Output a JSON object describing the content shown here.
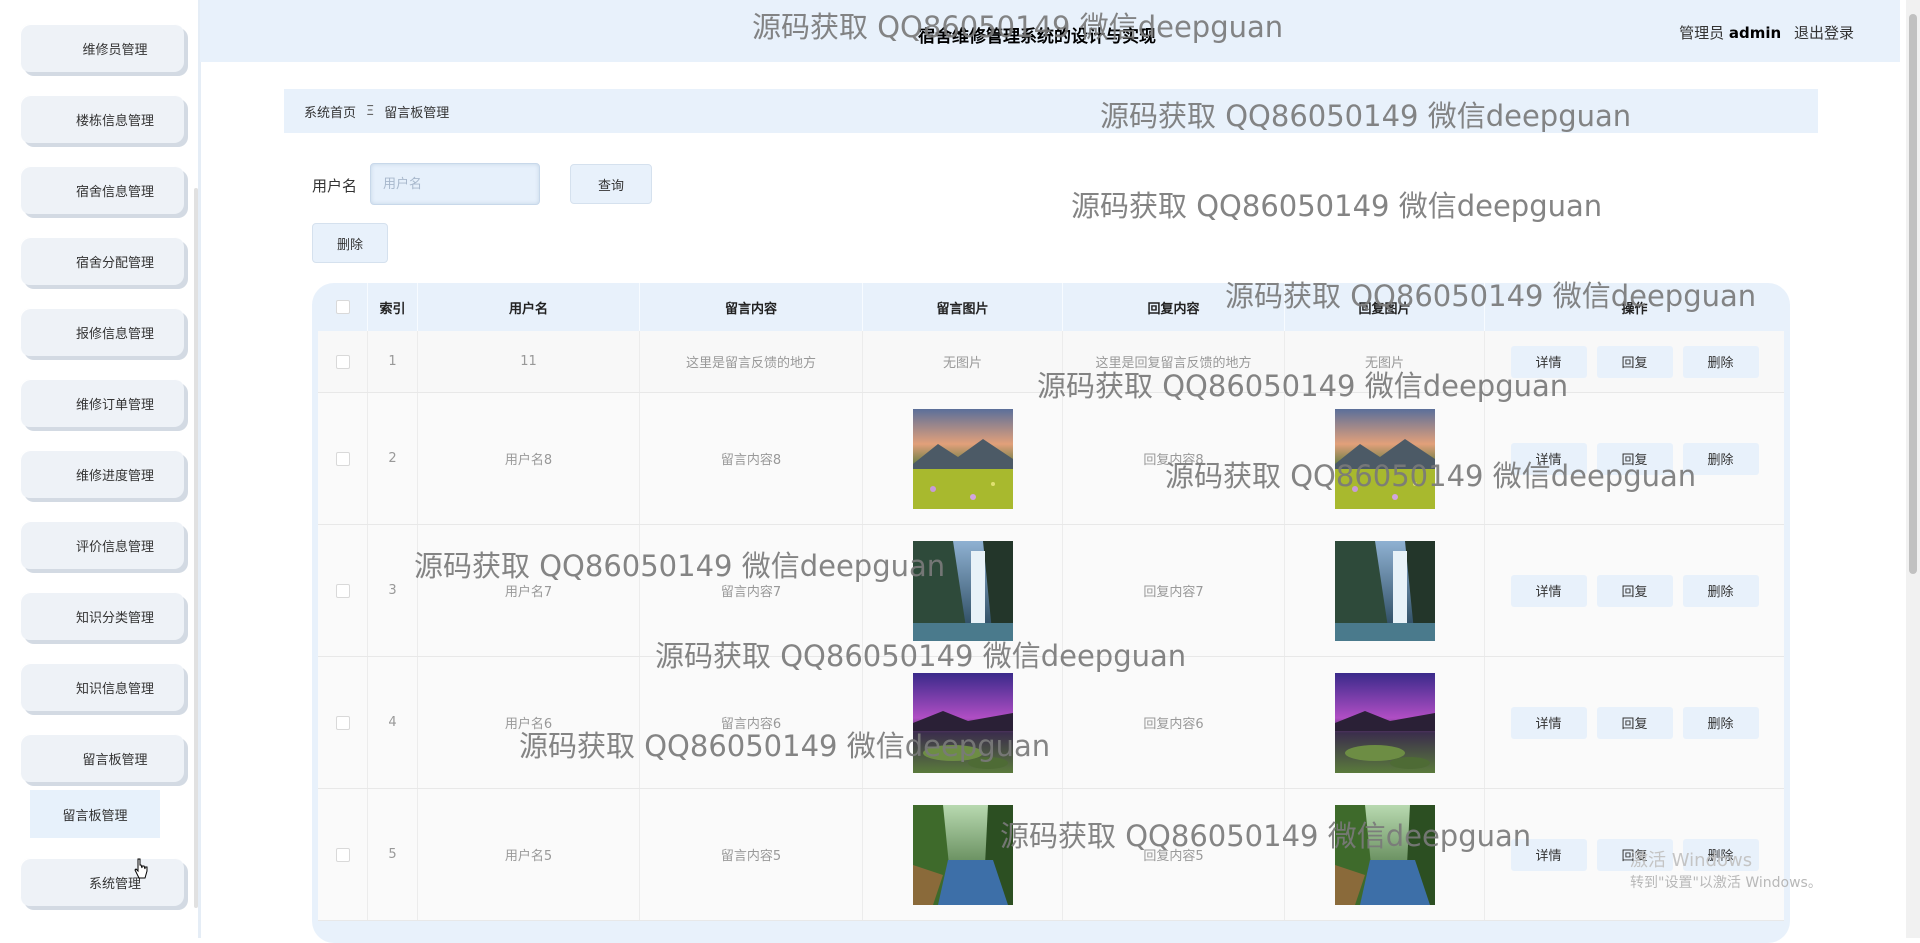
{
  "header": {
    "title": "宿舍维修管理系统的设计与实现",
    "role_label": "管理员",
    "username": "admin",
    "logout_label": "退出登录"
  },
  "sidebar": {
    "items": [
      {
        "label": "维修员管理"
      },
      {
        "label": "楼栋信息管理"
      },
      {
        "label": "宿舍信息管理"
      },
      {
        "label": "宿舍分配管理"
      },
      {
        "label": "报修信息管理"
      },
      {
        "label": "维修订单管理"
      },
      {
        "label": "维修进度管理"
      },
      {
        "label": "评价信息管理"
      },
      {
        "label": "知识分类管理"
      },
      {
        "label": "知识信息管理"
      },
      {
        "label": "留言板管理"
      }
    ],
    "submenu_label": "留言板管理",
    "system_label": "系统管理"
  },
  "breadcrumb": {
    "home": "系统首页",
    "separator": "Ξ",
    "current": "留言板管理"
  },
  "search": {
    "label": "用户名",
    "placeholder": "用户名",
    "value": "",
    "query_label": "查询",
    "delete_label": "删除"
  },
  "table": {
    "headers": {
      "index": "索引",
      "username": "用户名",
      "content": "留言内容",
      "image": "留言图片",
      "reply": "回复内容",
      "reply_image": "回复图片",
      "actions": "操作"
    },
    "action_labels": {
      "detail": "详情",
      "reply": "回复",
      "delete": "删除"
    },
    "rows": [
      {
        "index": "1",
        "username": "11",
        "content": "这里是留言反馈的地方",
        "image_text": "无图片",
        "reply": "这里是回复留言反馈的地方",
        "reply_image_text": "无图片",
        "image_type": "none"
      },
      {
        "index": "2",
        "username": "用户名8",
        "content": "留言内容8",
        "image_text": "",
        "reply": "回复内容8",
        "reply_image_text": "",
        "image_type": "meadow"
      },
      {
        "index": "3",
        "username": "用户名7",
        "content": "留言内容7",
        "image_text": "",
        "reply": "回复内容7",
        "reply_image_text": "",
        "image_type": "waterfall"
      },
      {
        "index": "4",
        "username": "用户名6",
        "content": "留言内容6",
        "image_text": "",
        "reply": "回复内容6",
        "reply_image_text": "",
        "image_type": "purple-coast"
      },
      {
        "index": "5",
        "username": "用户名5",
        "content": "留言内容5",
        "image_text": "",
        "reply": "回复内容5",
        "reply_image_text": "",
        "image_type": "forest-river"
      }
    ]
  },
  "watermark": "源码获取 QQ86050149 微信deepguan",
  "windows_activation": {
    "line1": "激活 Windows",
    "line2": "转到\"设置\"以激活 Windows。"
  }
}
